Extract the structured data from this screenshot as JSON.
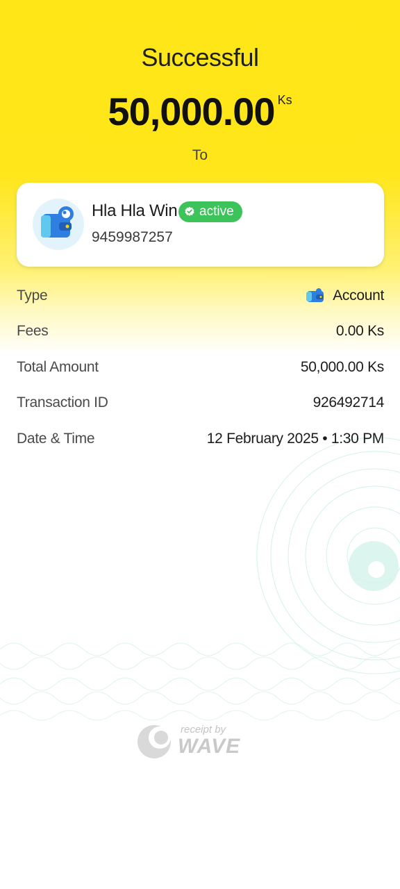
{
  "status": {
    "title": "Successful"
  },
  "amount": {
    "value": "50,000.00",
    "currency": "Ks"
  },
  "to_label": "To",
  "recipient": {
    "name": "Hla Hla Win",
    "badge": "active",
    "phone": "9459987257",
    "avatar_icon": "wallet-icon",
    "badge_icon": "verified-check-icon"
  },
  "details": [
    {
      "label": "Type",
      "value": "Account",
      "icon": "account-wallet-icon"
    },
    {
      "label": "Fees",
      "value": "0.00 Ks"
    },
    {
      "label": "Total Amount",
      "value": "50,000.00 Ks"
    },
    {
      "label": "Transaction ID",
      "value": "926492714"
    },
    {
      "label": "Date & Time",
      "value": "12 February 2025 • 1:30 PM"
    }
  ],
  "branding": {
    "small": "receipt by",
    "big": "WAVE"
  },
  "colors": {
    "header_yellow": "#ffe617",
    "badge_green": "#3cc35a",
    "watermark": "#a8e6d8"
  }
}
